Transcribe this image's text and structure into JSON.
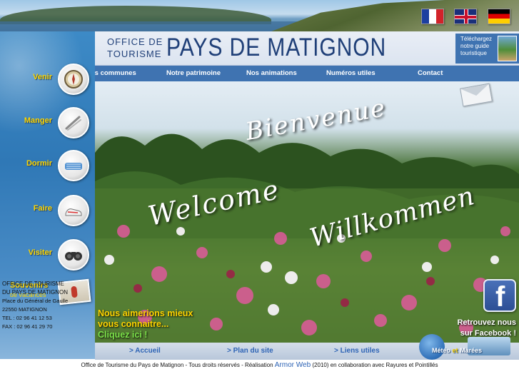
{
  "languages": [
    {
      "name": "Français",
      "icon": "flag-france-icon"
    },
    {
      "name": "English",
      "icon": "flag-uk-icon"
    },
    {
      "name": "Deutsch",
      "icon": "flag-germany-icon"
    }
  ],
  "header": {
    "office_de": "OFFICE DE",
    "tourisme": "TOURISME",
    "title": "PAYS DE MATIGNON",
    "guide_text": "Téléchargez notre guide touristique"
  },
  "topnav": {
    "items": [
      "Nos communes",
      "Notre patrimoine",
      "Nos animations",
      "Numéros utiles",
      "Contact"
    ]
  },
  "sidebar": {
    "items": [
      {
        "label": "Venir",
        "icon": "compass-icon"
      },
      {
        "label": "Manger",
        "icon": "fork-knife-icon"
      },
      {
        "label": "Dormir",
        "icon": "bed-icon"
      },
      {
        "label": "Faire",
        "icon": "sneakers-icon"
      },
      {
        "label": "Visiter",
        "icon": "binoculars-icon"
      }
    ],
    "souvenirs": {
      "title": "Souvenirs",
      "subtitle": "de vacances"
    },
    "contact": {
      "line1": "OFFICE DE TOURISME",
      "line2": "DU PAYS DE MATIGNON",
      "line3": "Place du Général de Gaulle",
      "line4": "22550 MATIGNON",
      "tel": "TEL : 02 96 41 12 53",
      "fax": "FAX : 02 96 41 29 70"
    }
  },
  "hero": {
    "bienvenue": "Bienvenue",
    "welcome": "Welcome",
    "willkommen": "Willkommen",
    "know_line1": "Nous aimerions mieux",
    "know_line2": "vous connaitre...",
    "know_cta": "Cliquez ici !",
    "fb_line1": "Retrouvez nous",
    "fb_line2": "sur Facebook !"
  },
  "bottombar": {
    "accueil": "> Accueil",
    "plan": "> Plan du site",
    "liens": "> Liens utiles",
    "meteo": "Météo",
    "et": "et",
    "marees": "Marées"
  },
  "footer": {
    "before": "Office de Tourisme du Pays de Matignon - Tous droits réservés - Réalisation ",
    "armor": "Armor Web",
    "after": " (2010) en collaboration avec Rayures et Pointillés"
  }
}
